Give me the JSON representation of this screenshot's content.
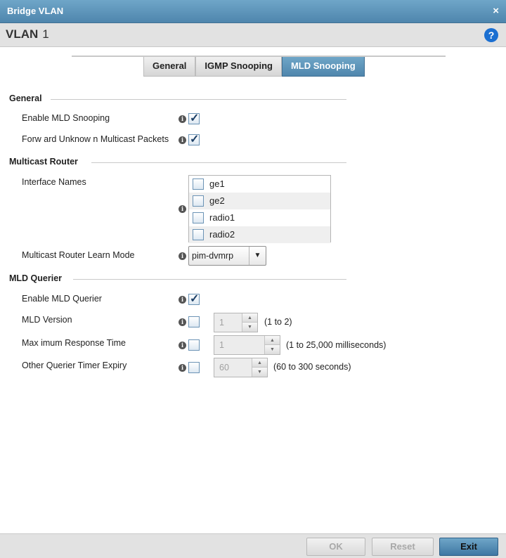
{
  "window": {
    "title": "Bridge VLAN",
    "close_glyph": "×"
  },
  "header": {
    "vlan_label": "VLAN",
    "vlan_id": "1",
    "help_glyph": "?"
  },
  "tabs": [
    {
      "label": "General",
      "active": false
    },
    {
      "label": "IGMP Snooping",
      "active": false
    },
    {
      "label": "MLD Snooping",
      "active": true
    }
  ],
  "general": {
    "heading": "General",
    "enable_mld_snooping": {
      "label": "Enable MLD Snooping",
      "checked": true
    },
    "forward_unknown": {
      "label": "Forw ard Unknow n Multicast Packets",
      "checked": true
    }
  },
  "multicast_router": {
    "heading": "Multicast Router",
    "interface_names_label": "Interface Names",
    "interfaces": [
      {
        "name": "ge1",
        "checked": false
      },
      {
        "name": "ge2",
        "checked": false
      },
      {
        "name": "radio1",
        "checked": false
      },
      {
        "name": "radio2",
        "checked": false
      }
    ],
    "learn_mode_label": "Multicast Router Learn Mode",
    "learn_mode_value": "pim-dvmrp"
  },
  "mld_querier": {
    "heading": "MLD Querier",
    "enable_querier": {
      "label": "Enable MLD Querier",
      "checked": true
    },
    "version": {
      "label": "MLD Version",
      "value": "1",
      "range": "(1 to 2)",
      "checked": false
    },
    "max_response": {
      "label": "Max imum Response Time",
      "value": "1",
      "range": "(1 to 25,000 milliseconds)",
      "checked": false
    },
    "other_querier": {
      "label": "Other Querier Timer Expiry",
      "value": "60",
      "range": "(60 to 300 seconds)",
      "checked": false
    }
  },
  "footer": {
    "ok_label": "OK",
    "reset_label": "Reset",
    "exit_label": "Exit"
  },
  "icons": {
    "info": "info-icon",
    "check": "checkmark-icon",
    "help": "help-icon",
    "close": "close-icon"
  },
  "colors": {
    "accent": "#5a8fb6",
    "help_blue": "#1b6fd1",
    "panel_gray": "#e2e2e2"
  }
}
